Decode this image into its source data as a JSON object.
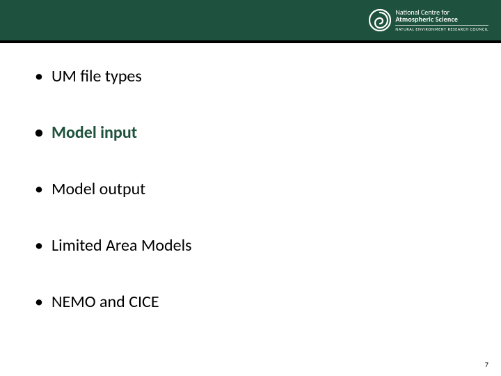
{
  "header": {
    "logo": {
      "line1": "National Centre for",
      "line2": "Atmospheric Science",
      "line3": "NATURAL ENVIRONMENT RESEARCH COUNCIL"
    }
  },
  "bullets": [
    {
      "text": "UM file types",
      "active": false
    },
    {
      "text": "Model input",
      "active": true
    },
    {
      "text": "Model output",
      "active": false
    },
    {
      "text": "Limited Area Models",
      "active": false
    },
    {
      "text": "NEMO and CICE",
      "active": false
    }
  ],
  "page_number": "7"
}
